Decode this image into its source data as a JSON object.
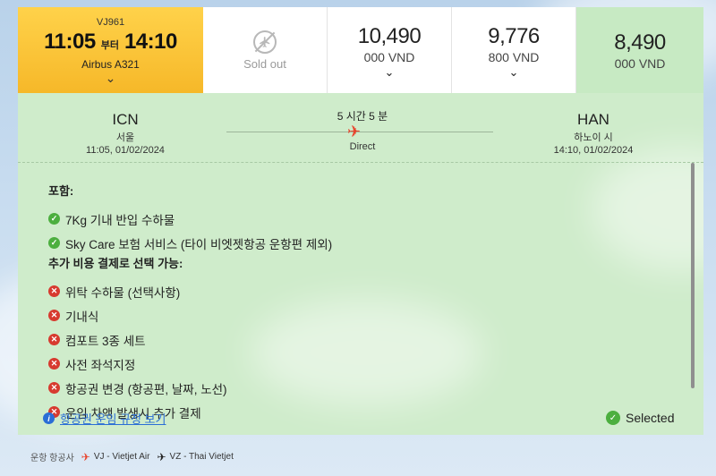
{
  "flight": {
    "number": "VJ961",
    "depart_time": "11:05",
    "from_word": "부터",
    "arrive_time": "14:10",
    "aircraft": "Airbus A321"
  },
  "fares": {
    "sold_out_label": "Sold out",
    "price1_main": "10,490",
    "price1_sub": "000 VND",
    "price2_main": "9,776",
    "price2_sub": "800 VND",
    "price3_main": "8,490",
    "price3_sub": "000 VND"
  },
  "route": {
    "dep_code": "ICN",
    "dep_city": "서울",
    "dep_datetime": "11:05, 01/02/2024",
    "duration": "5 시간 5 분",
    "direct": "Direct",
    "arr_code": "HAN",
    "arr_city": "하노이 시",
    "arr_datetime": "14:10, 01/02/2024"
  },
  "features": {
    "included_heading": "포함:",
    "included": [
      "7Kg 기내 반입 수하물",
      "Sky Care 보험 서비스 (타이 비엣젯항공 운항편 제외)"
    ],
    "optional_heading": "추가 비용 결제로 선택 가능:",
    "optional": [
      "위탁 수하물 (선택사항)",
      "기내식",
      "컴포트 3종 세트",
      "사전 좌석지정",
      "항공권 변경 (항공편, 날짜, 노선)",
      "운임 차액 발생시 추가 결제"
    ]
  },
  "fare_rules_link": "항공권 운임 규정 보기",
  "selected_label": "Selected",
  "legend": {
    "label": "운항 항공사",
    "vj": "VJ - Vietjet Air",
    "vz": "VZ - Thai Vietjet"
  },
  "colors": {
    "flight_cell": "#f6b829",
    "selected_cell": "#c7eac3",
    "detail_bg": "#cfeccb",
    "ok_icon": "#4caf3f",
    "no_icon": "#d73a2f",
    "link": "#2b6ed6"
  }
}
